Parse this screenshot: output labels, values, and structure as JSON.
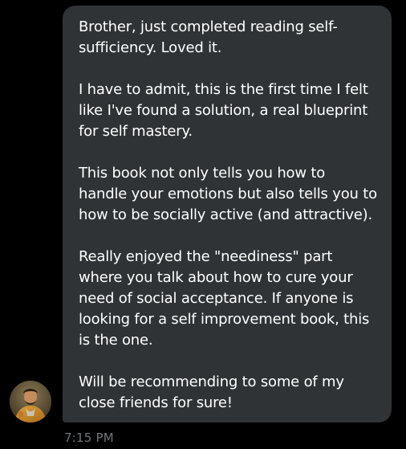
{
  "message": {
    "paragraphs": [
      "Brother, just completed reading self-sufficiency. Loved it.",
      "I have to admit, this is the first time I felt like I've found a solution, a real blueprint for self mastery.",
      "This book not only tells you how to handle your emotions but also tells you to how to be socially active (and attractive).",
      "Really enjoyed the \"neediness\" part where you talk about how to cure your need of social acceptance. If anyone is looking for a self improvement book, this is the one.",
      "Will be recommending to some of my close friends for sure!"
    ],
    "timestamp": "7:15 PM"
  },
  "sender": {
    "avatar_icon": "painted-portrait-avatar"
  },
  "colors": {
    "background": "#000000",
    "bubble": "#2f3336",
    "text": "#ffffff",
    "timestamp": "#71767b"
  }
}
